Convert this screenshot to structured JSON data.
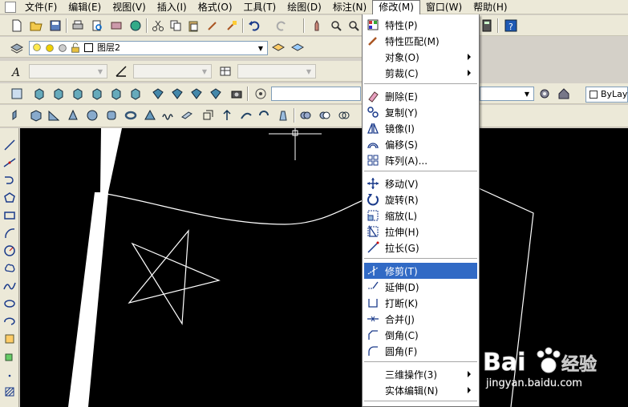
{
  "menubar": {
    "items": [
      "文件(F)",
      "编辑(E)",
      "视图(V)",
      "插入(I)",
      "格式(O)",
      "工具(T)",
      "绘图(D)",
      "标注(N)",
      "修改(M)",
      "窗口(W)",
      "帮助(H)"
    ],
    "active_index": 8
  },
  "layer_toolbar": {
    "layer_name": "图层2"
  },
  "properties": {
    "linetype_value": "ByLay"
  },
  "modify_menu": {
    "items": [
      {
        "label": "特性(P)",
        "icon": "properties-icon"
      },
      {
        "label": "特性匹配(M)",
        "icon": "match-properties-icon"
      },
      {
        "label": "对象(O)",
        "submenu": true
      },
      {
        "label": "剪裁(C)",
        "submenu": true
      },
      {
        "label": "删除(E)",
        "icon": "erase-icon"
      },
      {
        "label": "复制(Y)",
        "icon": "copy-icon"
      },
      {
        "label": "镜像(I)",
        "icon": "mirror-icon"
      },
      {
        "label": "偏移(S)",
        "icon": "offset-icon"
      },
      {
        "label": "阵列(A)...",
        "icon": "array-icon"
      },
      {
        "label": "移动(V)",
        "icon": "move-icon"
      },
      {
        "label": "旋转(R)",
        "icon": "rotate-icon"
      },
      {
        "label": "缩放(L)",
        "icon": "scale-icon"
      },
      {
        "label": "拉伸(H)",
        "icon": "stretch-icon"
      },
      {
        "label": "拉长(G)",
        "icon": "lengthen-icon"
      },
      {
        "label": "修剪(T)",
        "icon": "trim-icon",
        "highlighted": true
      },
      {
        "label": "延伸(D)",
        "icon": "extend-icon"
      },
      {
        "label": "打断(K)",
        "icon": "break-icon"
      },
      {
        "label": "合并(J)",
        "icon": "join-icon"
      },
      {
        "label": "倒角(C)",
        "icon": "chamfer-icon"
      },
      {
        "label": "圆角(F)",
        "icon": "fillet-icon"
      },
      {
        "label": "三维操作(3)",
        "submenu": true
      },
      {
        "label": "实体编辑(N)",
        "submenu": true
      }
    ]
  },
  "watermark": {
    "brand": "Bai",
    "brand_suffix": "经验",
    "url": "jingyan.baidu.com"
  },
  "colors": {
    "highlight": "#316ac5",
    "canvas": "#000000",
    "chrome": "#ece9d8",
    "drawing_line": "#ffffff"
  }
}
